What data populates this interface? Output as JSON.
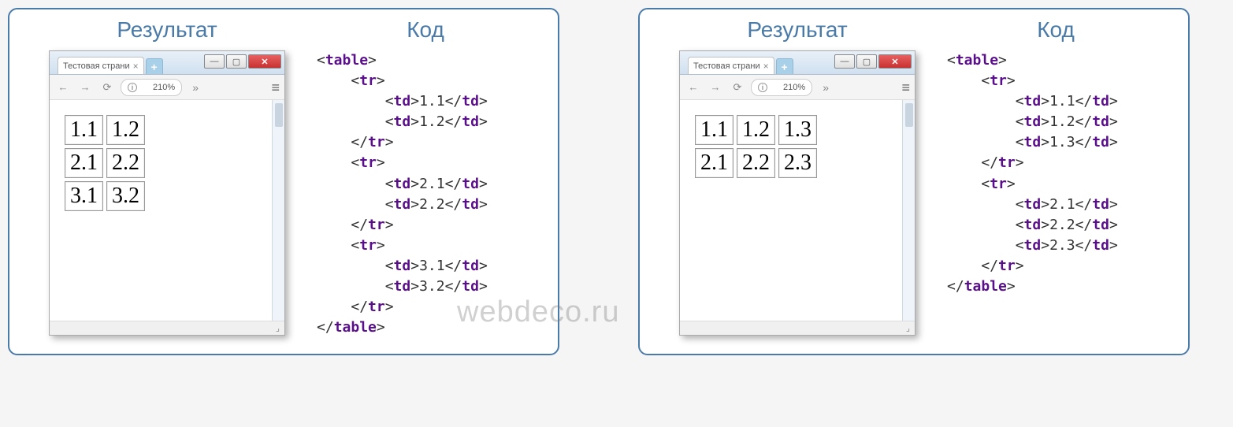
{
  "headers": {
    "result": "Результат",
    "code": "Код"
  },
  "browser": {
    "tab_title": "Тестовая страни",
    "tab_close": "×",
    "newtab": "+",
    "minimize": "—",
    "maximize": "▢",
    "close": "✕",
    "back": "←",
    "forward": "→",
    "reload": "⟳",
    "info": "i",
    "zoom": "210%",
    "overflow": "»",
    "menu": "≡",
    "resize": "⌟"
  },
  "watermark": "webdeco.ru",
  "panels": [
    {
      "table": [
        [
          "1.1",
          "1.2"
        ],
        [
          "2.1",
          "2.2"
        ],
        [
          "3.1",
          "3.2"
        ]
      ],
      "code_rows": [
        {
          "indent": 0,
          "open": "table",
          "close": ""
        },
        {
          "indent": 1,
          "open": "tr",
          "close": ""
        },
        {
          "indent": 2,
          "open": "td",
          "text": "1.1",
          "close": "td"
        },
        {
          "indent": 2,
          "open": "td",
          "text": "1.2",
          "close": "td"
        },
        {
          "indent": 1,
          "open": "",
          "close": "tr"
        },
        {
          "indent": 1,
          "open": "tr",
          "close": ""
        },
        {
          "indent": 2,
          "open": "td",
          "text": "2.1",
          "close": "td"
        },
        {
          "indent": 2,
          "open": "td",
          "text": "2.2",
          "close": "td"
        },
        {
          "indent": 1,
          "open": "",
          "close": "tr"
        },
        {
          "indent": 1,
          "open": "tr",
          "close": ""
        },
        {
          "indent": 2,
          "open": "td",
          "text": "3.1",
          "close": "td"
        },
        {
          "indent": 2,
          "open": "td",
          "text": "3.2",
          "close": "td"
        },
        {
          "indent": 1,
          "open": "",
          "close": "tr"
        },
        {
          "indent": 0,
          "open": "",
          "close": "table"
        }
      ]
    },
    {
      "table": [
        [
          "1.1",
          "1.2",
          "1.3"
        ],
        [
          "2.1",
          "2.2",
          "2.3"
        ]
      ],
      "code_rows": [
        {
          "indent": 0,
          "open": "table",
          "close": ""
        },
        {
          "indent": 1,
          "open": "tr",
          "close": ""
        },
        {
          "indent": 2,
          "open": "td",
          "text": "1.1",
          "close": "td"
        },
        {
          "indent": 2,
          "open": "td",
          "text": "1.2",
          "close": "td"
        },
        {
          "indent": 2,
          "open": "td",
          "text": "1.3",
          "close": "td"
        },
        {
          "indent": 1,
          "open": "",
          "close": "tr"
        },
        {
          "indent": 1,
          "open": "tr",
          "close": ""
        },
        {
          "indent": 2,
          "open": "td",
          "text": "2.1",
          "close": "td"
        },
        {
          "indent": 2,
          "open": "td",
          "text": "2.2",
          "close": "td"
        },
        {
          "indent": 2,
          "open": "td",
          "text": "2.3",
          "close": "td"
        },
        {
          "indent": 1,
          "open": "",
          "close": "tr"
        },
        {
          "indent": 0,
          "open": "",
          "close": "table"
        }
      ]
    }
  ]
}
